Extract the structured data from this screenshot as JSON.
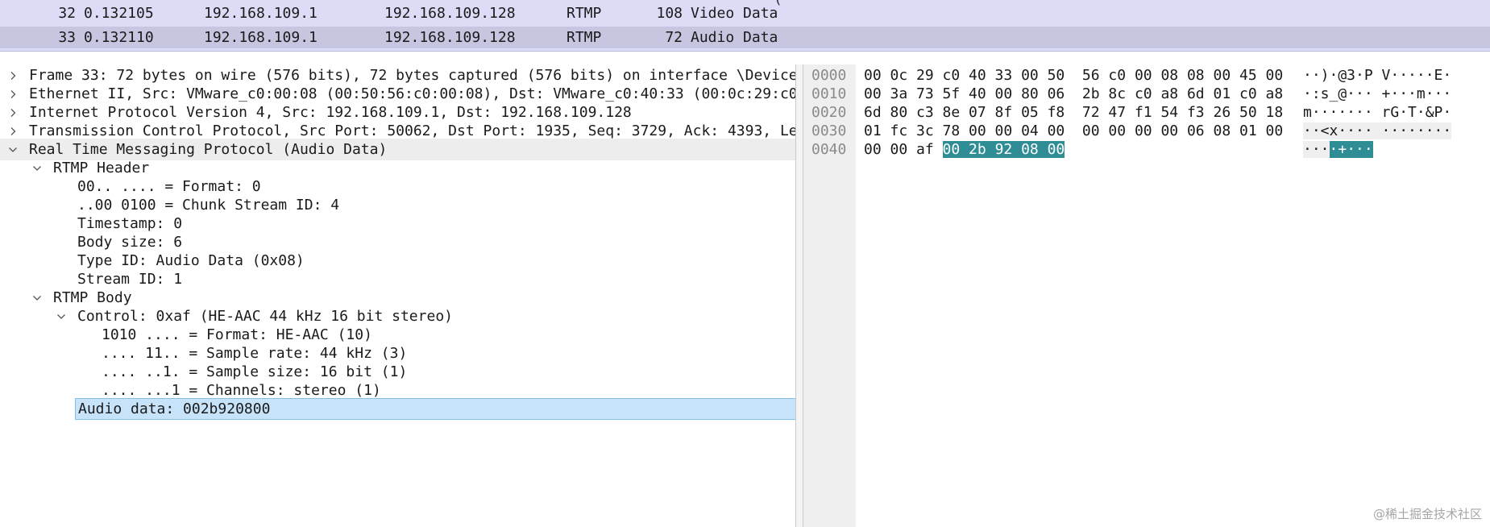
{
  "packet_list": {
    "top_clip": "(",
    "rows": [
      {
        "no": "32",
        "time": "0.132105",
        "src": "192.168.109.1",
        "dst": "192.168.109.128",
        "proto": "RTMP",
        "len": "108",
        "info": "Video Data",
        "selected": false
      },
      {
        "no": "33",
        "time": "0.132110",
        "src": "192.168.109.1",
        "dst": "192.168.109.128",
        "proto": "RTMP",
        "len": "72",
        "info": "Audio Data",
        "selected": true
      }
    ]
  },
  "details": {
    "rows": [
      {
        "text": "Frame 33: 72 bytes on wire (576 bits), 72 bytes captured (576 bits) on interface \\Device\\",
        "level": 0,
        "expander": "collapsed"
      },
      {
        "text": "Ethernet II, Src: VMware_c0:00:08 (00:50:56:c0:00:08), Dst: VMware_c0:40:33 (00:0c:29:c0:",
        "level": 0,
        "expander": "collapsed"
      },
      {
        "text": "Internet Protocol Version 4, Src: 192.168.109.1, Dst: 192.168.109.128",
        "level": 0,
        "expander": "collapsed"
      },
      {
        "text": "Transmission Control Protocol, Src Port: 50062, Dst Port: 1935, Seq: 3729, Ack: 4393, Len",
        "level": 0,
        "expander": "collapsed"
      },
      {
        "text": "Real Time Messaging Protocol (Audio Data)",
        "level": 0,
        "expander": "expanded"
      },
      {
        "text": "RTMP Header",
        "level": 1,
        "expander": "expanded"
      },
      {
        "text": "00.. .... = Format: 0",
        "level": 2,
        "expander": "none"
      },
      {
        "text": "..00 0100 = Chunk Stream ID: 4",
        "level": 2,
        "expander": "none"
      },
      {
        "text": "Timestamp: 0",
        "level": 2,
        "expander": "none"
      },
      {
        "text": "Body size: 6",
        "level": 2,
        "expander": "none"
      },
      {
        "text": "Type ID: Audio Data (0x08)",
        "level": 2,
        "expander": "none"
      },
      {
        "text": "Stream ID: 1",
        "level": 2,
        "expander": "none"
      },
      {
        "text": "RTMP Body",
        "level": 1,
        "expander": "expanded"
      },
      {
        "text": "Control: 0xaf (HE-AAC 44 kHz 16 bit stereo)",
        "level": 2,
        "expander": "expanded"
      },
      {
        "text": "1010 .... = Format: HE-AAC (10)",
        "level": 3,
        "expander": "none"
      },
      {
        "text": ".... 11.. = Sample rate: 44 kHz (3)",
        "level": 3,
        "expander": "none"
      },
      {
        "text": ".... ..1. = Sample size: 16 bit (1)",
        "level": 3,
        "expander": "none"
      },
      {
        "text": ".... ...1 = Channels: stereo (1)",
        "level": 3,
        "expander": "none"
      },
      {
        "text": "Audio data: 002b920800",
        "level": 2,
        "expander": "none",
        "selected": true
      }
    ]
  },
  "bytes": {
    "rows": [
      {
        "offset": "0000",
        "hex_plain": "00 0c 29 c0 40 33 00 50  56 c0 00 08 08 00 45 00",
        "hex_hl": "",
        "ascii_plain": "··)·@3·P V·····E·",
        "ascii_hl": ""
      },
      {
        "offset": "0010",
        "hex_plain": "00 3a 73 5f 40 00 80 06  2b 8c c0 a8 6d 01 c0 a8",
        "hex_hl": "",
        "ascii_plain": "·:s_@··· +···m···",
        "ascii_hl": ""
      },
      {
        "offset": "0020",
        "hex_plain": "6d 80 c3 8e 07 8f 05 f8  72 47 f1 54 f3 26 50 18",
        "hex_hl": "",
        "ascii_plain": "m······· rG·T·&P·",
        "ascii_hl": ""
      },
      {
        "offset": "0030",
        "hex_plain": "01 fc 3c 78 00 00 04 00  00 00 00 00 06 08 01 00",
        "hex_hl": "",
        "ascii_plain": "··<x···· ········",
        "ascii_hl": ""
      },
      {
        "offset": "0040",
        "hex_plain": "00 00 af ",
        "hex_hl": "00 2b 92 08 00",
        "ascii_plain": "···",
        "ascii_hl": "·+···"
      }
    ]
  },
  "watermark": "@稀土掘金技术社区",
  "colors": {
    "packet_list_bg": "#dcdcf6",
    "selected_packet": "#c6c6e0",
    "selected_field": "#c6e3fa",
    "byte_highlight": "#2f8d96"
  }
}
